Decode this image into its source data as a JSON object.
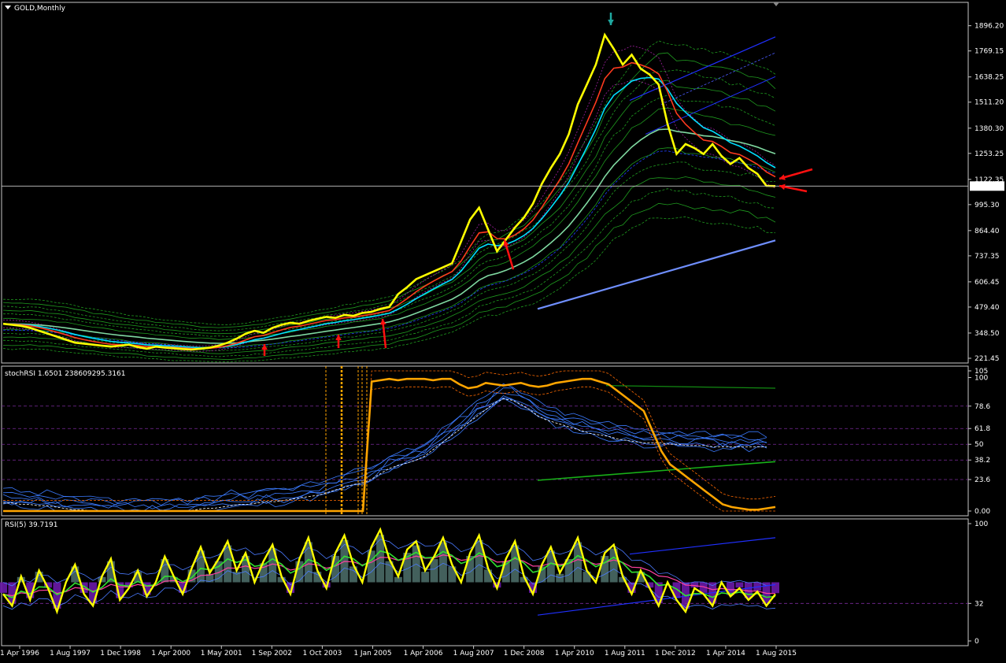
{
  "window": {
    "title": "GOLD,Monthly"
  },
  "colors": {
    "background": "#000000",
    "frame": "#c8c8c8",
    "price": "#ffff00",
    "ema_fast": "#ff3a1e",
    "ema_mid": "#00e0ff",
    "ma_slow": "#7fd8a0",
    "bands": "#1f9b1f",
    "trend": "#6f8fff",
    "stoch_main": "#ffa500",
    "stoch_blue": "#3b7bff",
    "rsi_main": "#ffff00",
    "hist_pos": "#4a6a66",
    "hist_neg": "#6a1aa8",
    "grid": "#7a2a9a",
    "arrow_red": "#ff1010",
    "arrow_teal": "#1fa8a0"
  },
  "chart_data": [
    {
      "type": "line",
      "title": "GOLD,Monthly",
      "ylim": [
        221.45,
        1990
      ],
      "yticks": [
        "1896.20",
        "1769.15",
        "1638.25",
        "1511.20",
        "1380.30",
        "1253.25",
        "1122.35",
        "995.30",
        "864.40",
        "737.35",
        "606.45",
        "479.40",
        "348.50",
        "221.45"
      ],
      "current_price": "1088.69",
      "x_dates": [
        "1 Apr 1996",
        "1 Aug 1997",
        "1 Dec 1998",
        "1 Apr 2000",
        "1 May 2001",
        "1 Sep 2002",
        "1 Oct 2003",
        "1 Jan 2005",
        "1 Apr 2006",
        "1 Aug 2007",
        "1 Dec 2008",
        "1 Apr 2010",
        "1 Aug 2011",
        "1 Dec 2012",
        "1 Apr 2014",
        "1 Aug 2015"
      ],
      "series": [
        {
          "values": [
            395,
            390,
            385,
            375,
            360,
            345,
            330,
            315,
            300,
            295,
            290,
            285,
            280,
            285,
            290,
            278,
            270,
            280,
            275,
            272,
            268,
            265,
            270,
            275,
            285,
            300,
            320,
            345,
            360,
            350,
            375,
            390,
            400,
            395,
            410,
            420,
            430,
            425,
            440,
            435,
            450,
            455,
            470,
            480,
            545,
            580,
            620,
            640,
            660,
            680,
            700,
            810,
            920,
            980,
            870,
            760,
            820,
            880,
            930,
            1000,
            1100,
            1180,
            1250,
            1350,
            1500,
            1600,
            1700,
            1850,
            1780,
            1700,
            1750,
            1680,
            1650,
            1600,
            1400,
            1250,
            1300,
            1280,
            1250,
            1300,
            1240,
            1200,
            1230,
            1180,
            1150,
            1090,
            1088.69
          ]
        }
      ]
    },
    {
      "type": "line",
      "title": "stochRSI 1.6501 238609295.3161",
      "ylim": [
        0,
        105
      ],
      "yticks": [
        "105",
        "100",
        "78.6",
        "61.8",
        "50",
        "38.2",
        "23.6",
        "0.00"
      ],
      "series": [
        {
          "values": [
            0,
            0,
            0,
            0,
            0,
            0,
            0,
            0,
            0,
            0,
            0,
            0,
            0,
            0,
            0,
            0,
            0,
            0,
            0,
            0,
            0,
            0,
            0,
            0,
            0,
            0,
            0,
            0,
            0,
            0,
            0,
            0,
            0,
            0,
            0,
            0,
            0,
            0,
            0,
            0,
            0,
            0,
            97,
            98,
            99,
            98,
            99,
            99,
            99,
            98,
            99,
            99,
            95,
            92,
            93,
            96,
            95,
            94,
            95,
            96,
            94,
            93,
            94,
            96,
            97,
            98,
            99,
            99,
            97,
            95,
            90,
            85,
            80,
            75,
            60,
            45,
            35,
            30,
            25,
            20,
            15,
            10,
            5,
            3,
            2,
            1,
            1,
            2,
            3
          ]
        },
        {
          "values": [
            10,
            10,
            9,
            9,
            8,
            8,
            7,
            6,
            5,
            5,
            4,
            4,
            3,
            3,
            3,
            3,
            3,
            3,
            3,
            4,
            4,
            4,
            5,
            6,
            6,
            7,
            8,
            9,
            9,
            10,
            11,
            11,
            12,
            13,
            14,
            15,
            16,
            18,
            20,
            22,
            24,
            25,
            28,
            32,
            36,
            38,
            40,
            42,
            45,
            50,
            55,
            60,
            65,
            70,
            75,
            80,
            85,
            88,
            87,
            84,
            80,
            75,
            72,
            70,
            68,
            66,
            64,
            62,
            61,
            60,
            58,
            57,
            56,
            55,
            55,
            55,
            54,
            54,
            53,
            53,
            53,
            52,
            52,
            52,
            52,
            52,
            52,
            52
          ]
        }
      ]
    },
    {
      "type": "line",
      "title": "RSI(5) 39.7191",
      "ylim": [
        0,
        100
      ],
      "yticks": [
        "100",
        "32",
        "0"
      ],
      "series": [
        {
          "values": [
            40,
            30,
            55,
            35,
            60,
            45,
            25,
            50,
            65,
            40,
            30,
            55,
            70,
            35,
            45,
            60,
            38,
            50,
            72,
            55,
            40,
            62,
            80,
            58,
            70,
            85,
            60,
            75,
            50,
            68,
            82,
            55,
            40,
            70,
            88,
            60,
            45,
            75,
            90,
            65,
            50,
            80,
            95,
            70,
            55,
            78,
            85,
            60,
            72,
            88,
            65,
            50,
            75,
            90,
            62,
            45,
            70,
            85,
            55,
            40,
            65,
            80,
            58,
            72,
            88,
            60,
            50,
            75,
            82,
            55,
            40,
            60,
            45,
            30,
            50,
            35,
            25,
            45,
            40,
            30,
            50,
            38,
            45,
            35,
            42,
            30,
            39.72
          ]
        }
      ]
    }
  ]
}
